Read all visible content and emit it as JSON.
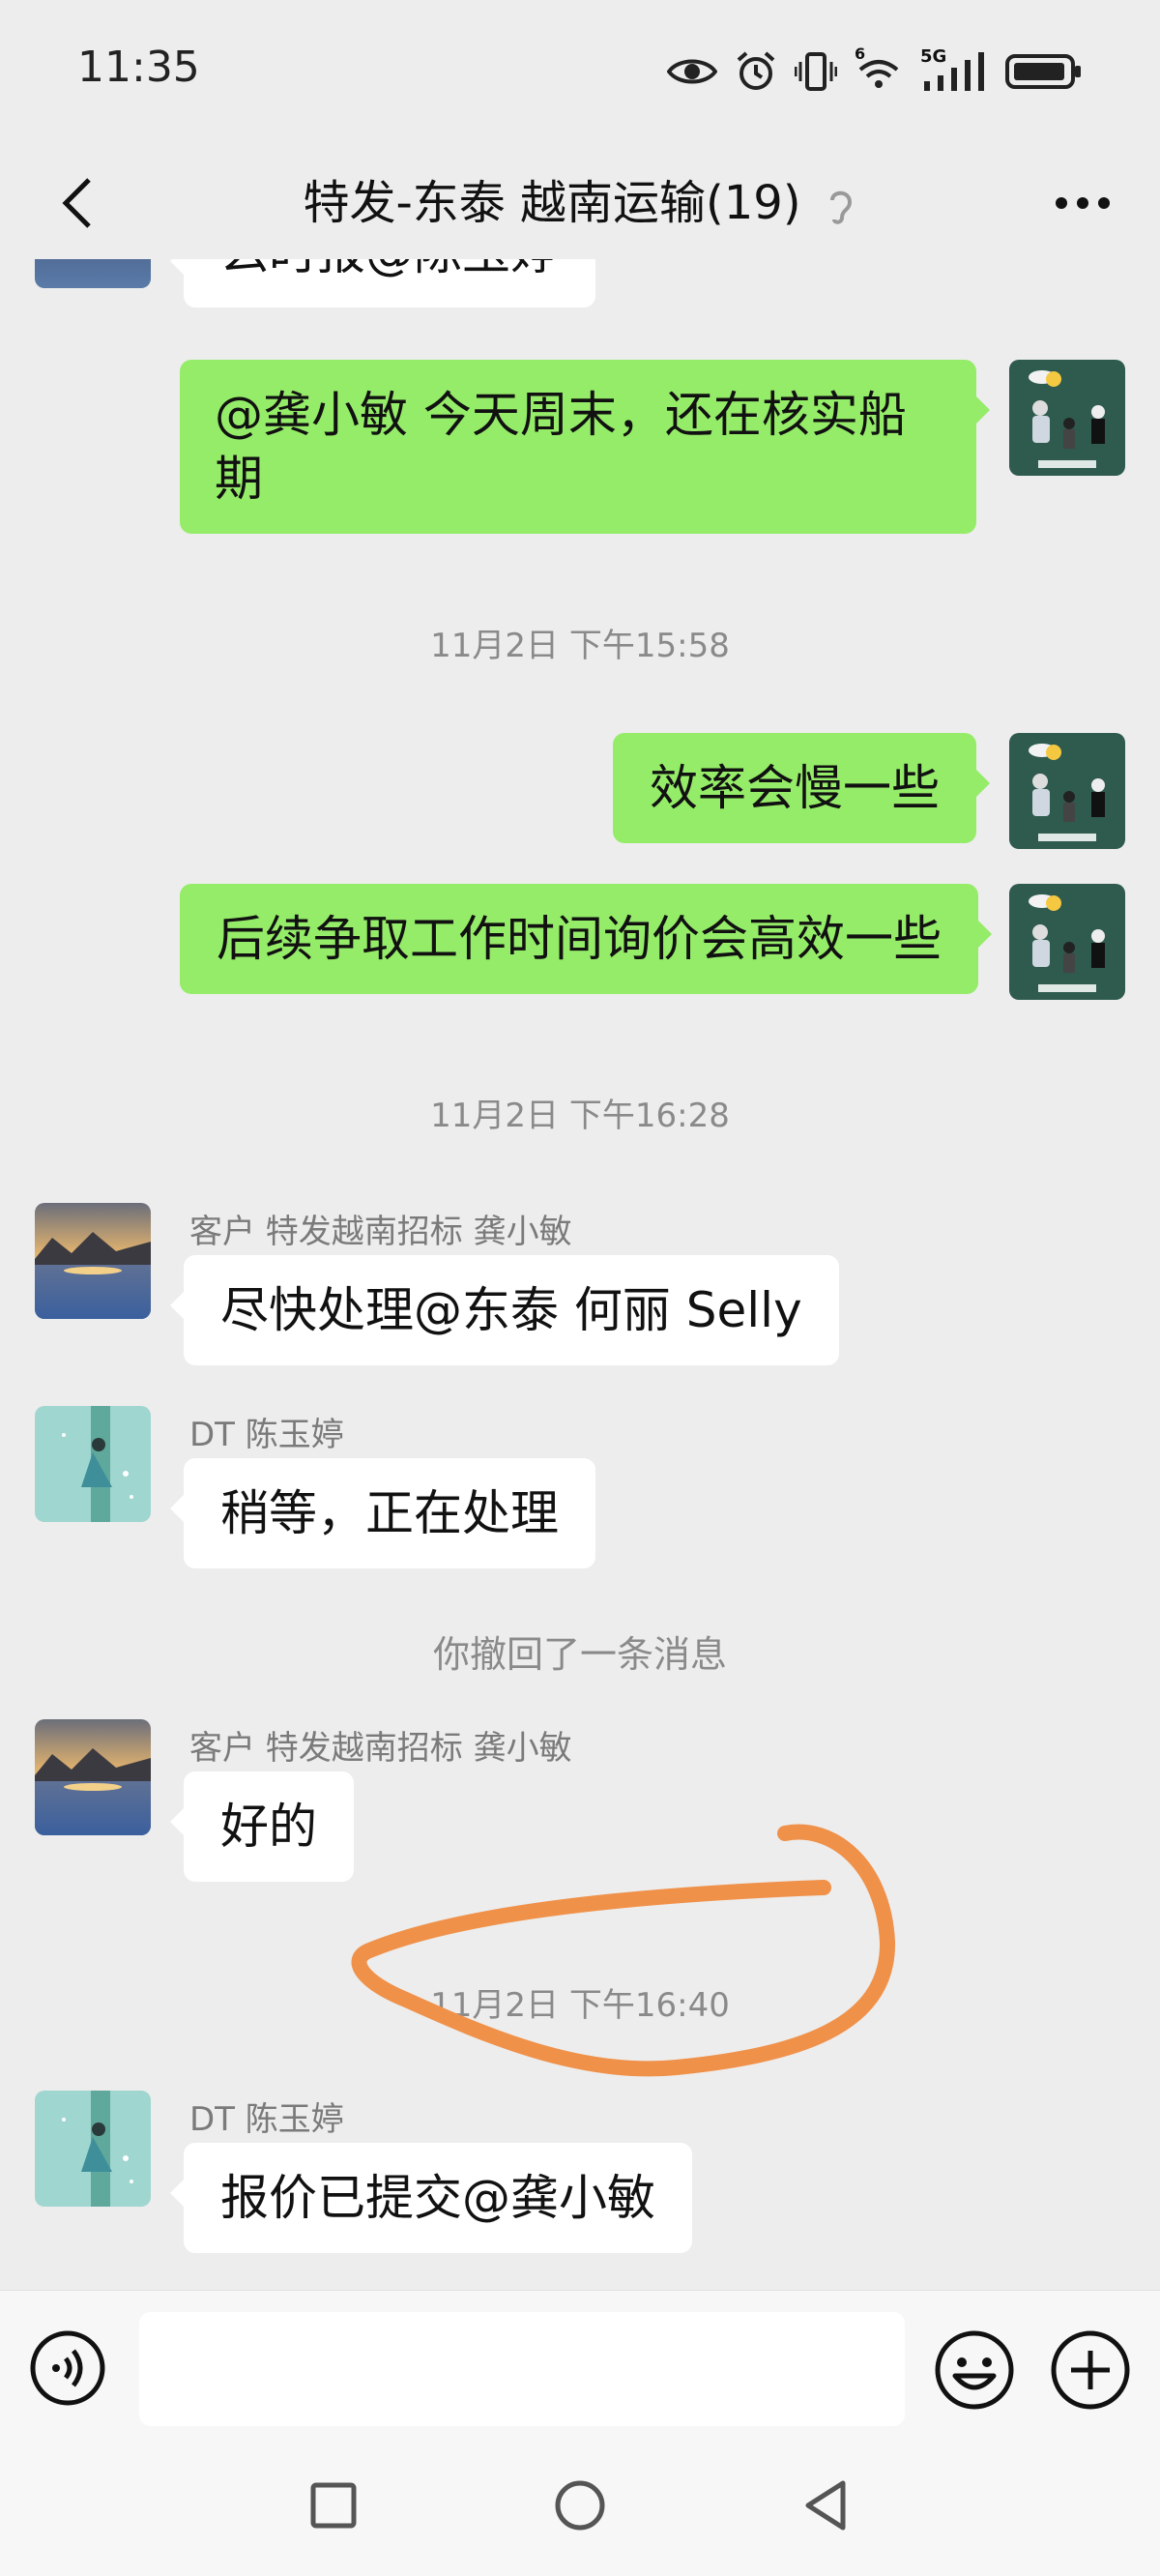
{
  "status_bar": {
    "time": "11:35",
    "signal_label": "5G",
    "sim_label": "6"
  },
  "header": {
    "title": "特发-东泰 越南运输(19)"
  },
  "messages": [
    {
      "side": "left",
      "text": "么时报@陈玉婷"
    },
    {
      "side": "right",
      "text_line1": "@龚小敏  今天周末，还在核实船",
      "text_line2": "期"
    },
    {
      "type": "time",
      "text": "11月2日 下午15:58"
    },
    {
      "side": "right",
      "text": "效率会慢一些"
    },
    {
      "side": "right",
      "text": "后续争取工作时间询价会高效一些"
    },
    {
      "type": "time",
      "text": "11月2日 下午16:28"
    },
    {
      "side": "left",
      "sender": "客户 特发越南招标 龚小敏",
      "text": "尽快处理@东泰 何丽 Selly"
    },
    {
      "side": "left",
      "sender": "DT 陈玉婷",
      "text": "稍等，正在处理"
    },
    {
      "type": "system",
      "text": "你撤回了一条消息"
    },
    {
      "side": "left",
      "sender": "客户 特发越南招标 龚小敏",
      "text": "好的"
    },
    {
      "type": "time",
      "text": "11月2日 下午16:40"
    },
    {
      "side": "left",
      "sender": "DT 陈玉婷",
      "text": "报价已提交@龚小敏"
    }
  ],
  "annotation": {
    "color": "#f0914a"
  },
  "input_bar": {
    "value": ""
  },
  "colors": {
    "background": "#ededed",
    "bubble_green": "#95ec69",
    "bubble_white": "#ffffff"
  }
}
